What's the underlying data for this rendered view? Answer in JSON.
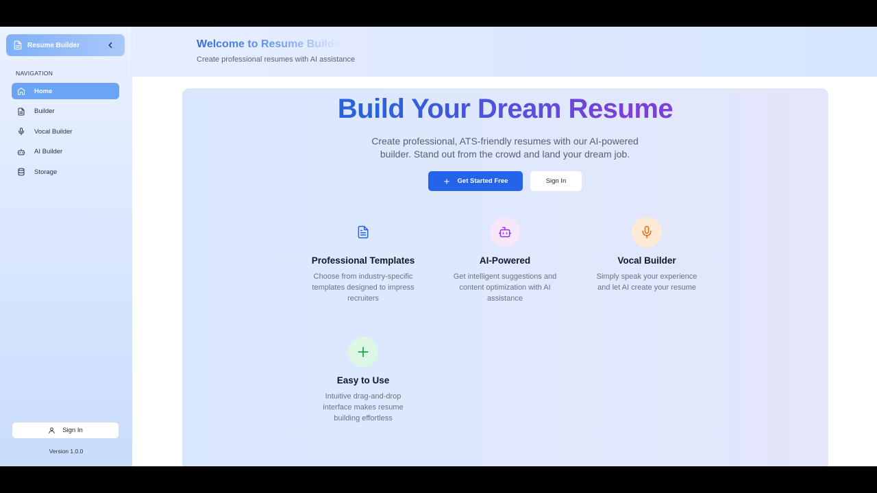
{
  "sidebar": {
    "brand": {
      "title": "Resume Builder",
      "icon": "file-text-icon",
      "collapse_icon": "chevron-left-icon"
    },
    "nav_heading": "NAVIGATION",
    "items": [
      {
        "label": "Home",
        "icon": "home-icon",
        "active": true
      },
      {
        "label": "Builder",
        "icon": "file-text-icon"
      },
      {
        "label": "Vocal Builder",
        "icon": "mic-icon"
      },
      {
        "label": "AI Builder",
        "icon": "bot-icon"
      },
      {
        "label": "Storage",
        "icon": "database-icon"
      }
    ],
    "sign_in": {
      "label": "Sign In",
      "icon": "user-icon"
    },
    "version": "Version 1.0.0"
  },
  "header": {
    "title": "Welcome to Resume Builder",
    "subtitle": "Create professional resumes with AI assistance"
  },
  "hero": {
    "title": "Build Your Dream Resume",
    "description": "Create professional, ATS-friendly resumes with our AI-powered builder. Stand out from the crowd and land your dream job.",
    "primary_button": {
      "label": "Get Started Free",
      "icon": "plus-icon"
    },
    "secondary_button": {
      "label": "Sign In"
    }
  },
  "features": [
    {
      "title": "Professional Templates",
      "description": "Choose from industry-specific templates designed to impress recruiters",
      "icon": "file-text-icon",
      "color": "#2563eb",
      "bg": "transparent"
    },
    {
      "title": "AI-Powered",
      "description": "Get intelligent suggestions and content optimization with AI assistance",
      "icon": "bot-icon",
      "color": "#9333ea",
      "bg": "#f6e7fb"
    },
    {
      "title": "Vocal Builder",
      "description": "Simply speak your experience and let AI create your resume",
      "icon": "mic-icon",
      "color": "#ea6a12",
      "bg": "#fde9d4"
    },
    {
      "title": "Easy to Use",
      "description": "Intuitive drag-and-drop interface makes resume building effortless",
      "icon": "plus-icon",
      "color": "#16a34a",
      "bg": "#dcf7e4"
    }
  ],
  "colors": {
    "accent": "#2563eb",
    "active_nav": "#6aa4f5"
  }
}
